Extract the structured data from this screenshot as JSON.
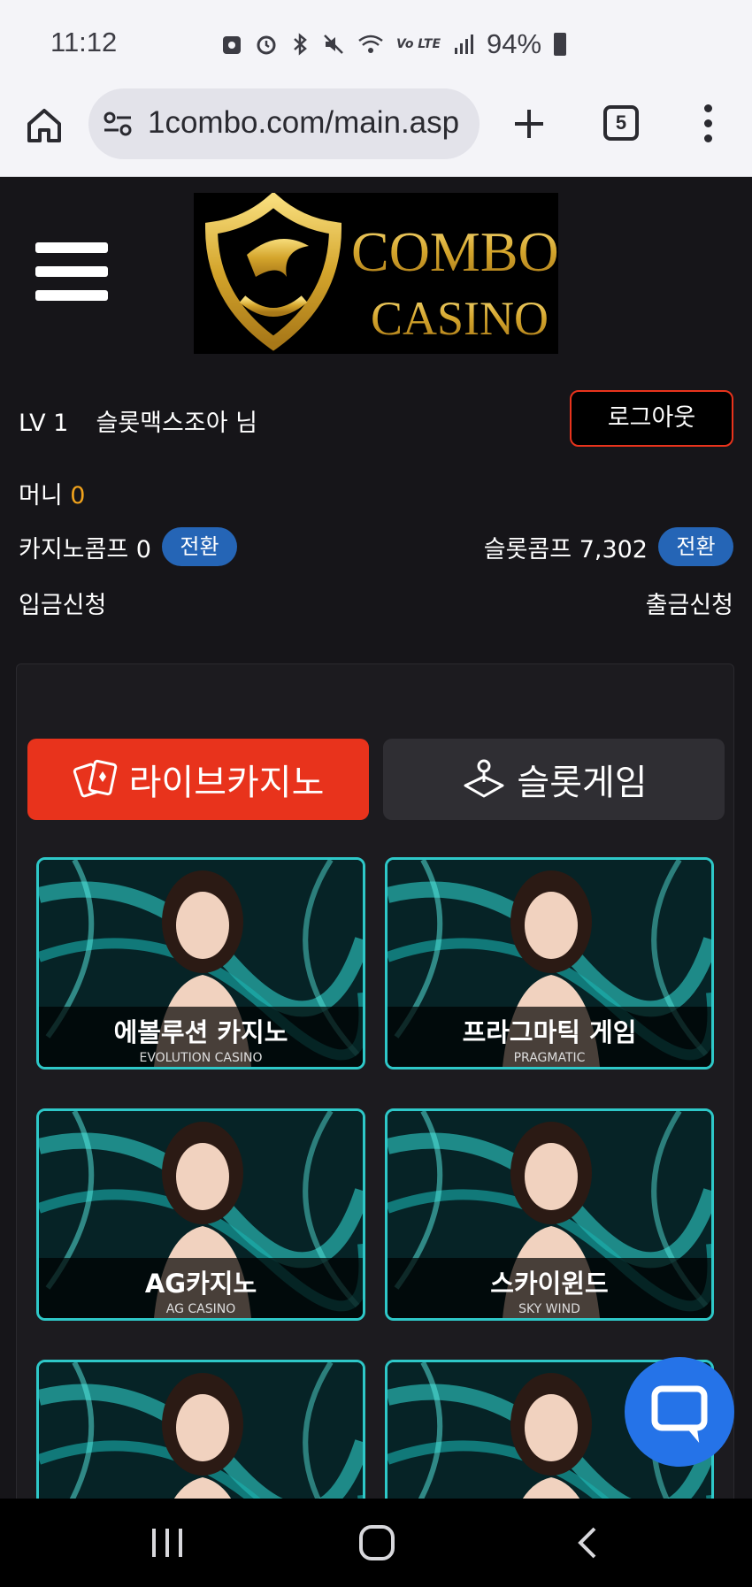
{
  "status_bar": {
    "time": "11:12",
    "battery": "94%",
    "icons": [
      "screenshot-icon",
      "alarm-icon",
      "bluetooth-icon",
      "mute-icon",
      "wifi-icon",
      "volte-icon",
      "signal-icon",
      "battery-icon"
    ],
    "volte_label": "Vo LTE"
  },
  "browser": {
    "url": "1combo.com/main.asp",
    "tab_count": "5"
  },
  "site": {
    "logo_text_1": "COMBO",
    "logo_text_2": "CASINO"
  },
  "user": {
    "level": "LV 1",
    "nickname": "슬롯맥스조아 님",
    "logout_label": "로그아웃",
    "money_label": "머니",
    "money_value": "0",
    "casino_comp_label": "카지노콤프 0",
    "slot_comp_label": "슬롯콤프 7,302",
    "convert_label": "전환",
    "deposit_label": "입금신청",
    "withdraw_label": "출금신청"
  },
  "tabs": {
    "live_casino": "라이브카지노",
    "slot_game": "슬롯게임"
  },
  "games": [
    {
      "ko": "에볼루션 카지노",
      "en": "EVOLUTION CASINO"
    },
    {
      "ko": "프라그마틱 게임",
      "en": "PRAGMATIC"
    },
    {
      "ko": "AG카지노",
      "en": "AG CASINO"
    },
    {
      "ko": "스카이윈드",
      "en": "SKY WIND"
    },
    {
      "ko": "",
      "en": ""
    },
    {
      "ko": "",
      "en": ""
    }
  ],
  "colors": {
    "accent_red": "#e8331c",
    "convert_blue": "#2565b6",
    "money_orange": "#f0a21c",
    "tile_border": "#2ec8c8",
    "chat_blue": "#2573e8"
  }
}
